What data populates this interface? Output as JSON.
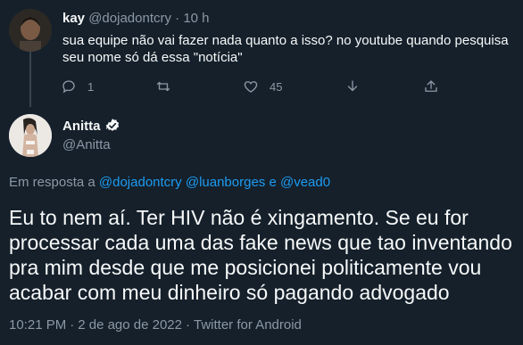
{
  "reply": {
    "name": "kay",
    "handle": "@dojadontcry",
    "separator": "·",
    "time": "10 h",
    "text": "sua equipe não vai fazer nada quanto a isso? no youtube quando pesquisa seu nome só dá essa \"notícia\"",
    "actions": {
      "reply_count": "1",
      "retweet_count": "",
      "like_count": "45"
    }
  },
  "tweet": {
    "name": "Anitta",
    "handle": "@Anitta",
    "replying_to_prefix": "Em resposta a",
    "mention_1": "@dojadontcry",
    "mention_2": "@luanborges",
    "conjunction": "e",
    "mention_3": "@vead0",
    "text": "Eu to nem aí. Ter HIV não é xingamento. Se eu for processar cada uma das fake news que tao inventando pra mim desde que me posicionei politicamente vou acabar com meu dinheiro só pagando advogado",
    "time": "10:21 PM",
    "date": "2 de ago de 2022",
    "source": "Twitter for Android",
    "meta_separator": "·"
  },
  "colors": {
    "background": "#15202b",
    "text": "#f7f9f9",
    "muted": "#8b98a5",
    "link": "#1d9bf0",
    "verified": "#1d9bf0"
  }
}
